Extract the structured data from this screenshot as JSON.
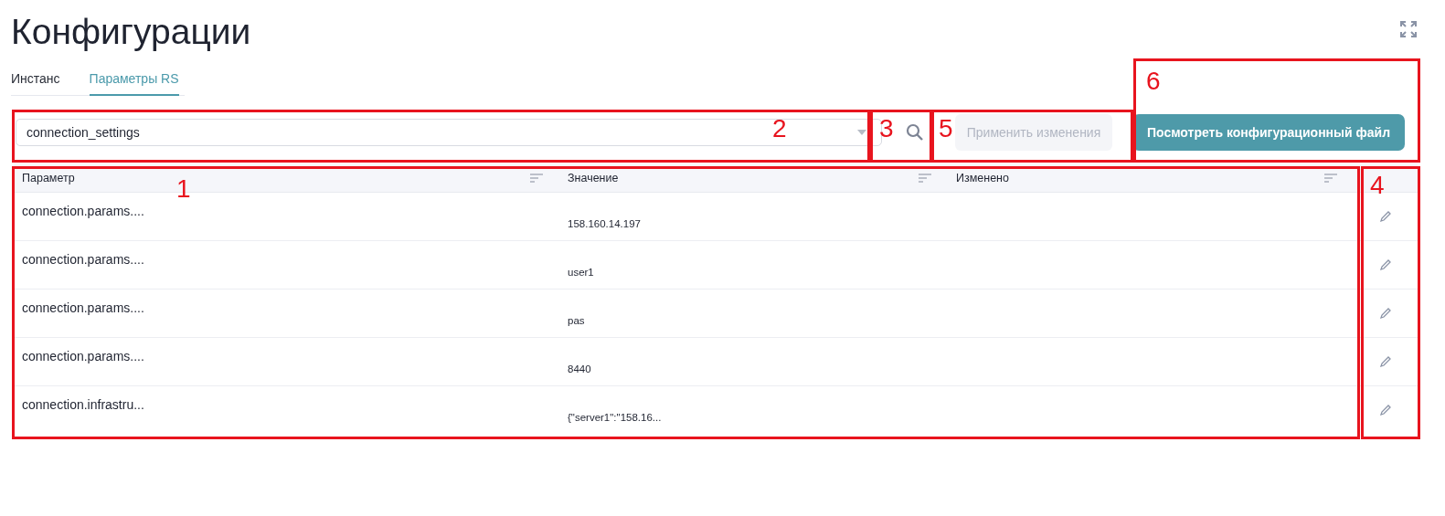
{
  "title": "Конфигурации",
  "tabs": [
    {
      "label": "Инстанс",
      "selected": false
    },
    {
      "label": "Параметры RS",
      "selected": true
    }
  ],
  "select": {
    "value": "connection_settings"
  },
  "apply_button": {
    "label": "Применить изменения",
    "disabled": true
  },
  "view_button": {
    "label": "Посмотреть конфигурационный файл"
  },
  "table": {
    "columns": [
      "Параметр",
      "Значение",
      "Изменено"
    ],
    "rows": [
      {
        "parameter": "connection.params....",
        "value": "158.160.14.197"
      },
      {
        "parameter": "connection.params....",
        "value": "user1"
      },
      {
        "parameter": "connection.params....",
        "value": "pas"
      },
      {
        "parameter": "connection.params....",
        "value": "8440"
      },
      {
        "parameter": "connection.infrastru...",
        "value": "{\"server1\":\"158.16..."
      }
    ]
  },
  "annotations": [
    {
      "label": "1"
    },
    {
      "label": "2"
    },
    {
      "label": "3"
    },
    {
      "label": "4"
    },
    {
      "label": "5"
    },
    {
      "label": "6"
    }
  ]
}
